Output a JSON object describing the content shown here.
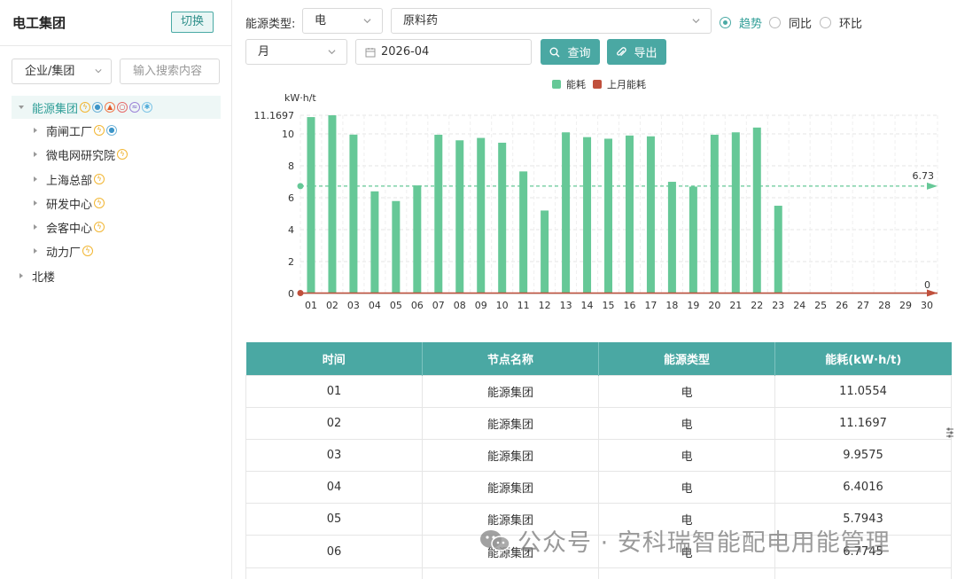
{
  "sidebar": {
    "title": "电工集团",
    "switch_label": "切换",
    "scope_select": "企业/集团",
    "search_placeholder": "输入搜索内容",
    "tree": [
      {
        "label": "能源集团",
        "level": 0,
        "expanded": true,
        "selected": true,
        "icons": [
          "electric",
          "water",
          "fire",
          "gas",
          "steam",
          "cold"
        ]
      },
      {
        "label": "南闸工厂",
        "level": 1,
        "icons": [
          "electric",
          "water"
        ]
      },
      {
        "label": "微电网研究院",
        "level": 1,
        "icons": [
          "electric"
        ]
      },
      {
        "label": "上海总部",
        "level": 1,
        "icons": [
          "electric"
        ]
      },
      {
        "label": "研发中心",
        "level": 1,
        "icons": [
          "electric"
        ]
      },
      {
        "label": "会客中心",
        "level": 1,
        "icons": [
          "electric"
        ]
      },
      {
        "label": "动力厂",
        "level": 1,
        "icons": [
          "electric"
        ]
      },
      {
        "label": "北楼",
        "level": 0,
        "icons": []
      }
    ]
  },
  "toolbar": {
    "energy_type_label": "能源类型:",
    "energy_type_value": "电",
    "material_value": "原料药",
    "radios": [
      {
        "label": "趋势",
        "checked": true
      },
      {
        "label": "同比",
        "checked": false
      },
      {
        "label": "环比",
        "checked": false
      }
    ],
    "period_value": "月",
    "date_value": "2026-04",
    "query_label": "查询",
    "export_label": "导出"
  },
  "colors": {
    "accent": "#4aa8a3",
    "bar": "#66c897",
    "prev_month": "#c0503c"
  },
  "chart_data": {
    "type": "bar",
    "unit_label": "kW·h/t",
    "legend": [
      "能耗",
      "上月能耗"
    ],
    "legend_position": "top-center",
    "categories": [
      "01",
      "02",
      "03",
      "04",
      "05",
      "06",
      "07",
      "08",
      "09",
      "10",
      "11",
      "12",
      "13",
      "14",
      "15",
      "16",
      "17",
      "18",
      "19",
      "20",
      "21",
      "22",
      "23",
      "24",
      "25",
      "26",
      "27",
      "28",
      "29",
      "30"
    ],
    "series": [
      {
        "name": "能耗",
        "values": [
          11.0554,
          11.1697,
          9.9575,
          6.4016,
          5.7943,
          6.7745,
          9.95,
          9.6,
          9.75,
          9.45,
          7.65,
          5.2,
          10.1,
          9.8,
          9.7,
          9.9,
          9.85,
          7.0,
          6.7,
          9.95,
          10.1,
          10.4,
          5.5,
          0,
          0,
          0,
          0,
          0,
          0,
          0
        ]
      },
      {
        "name": "上月能耗",
        "values": [
          0,
          0,
          0,
          0,
          0,
          0,
          0,
          0,
          0,
          0,
          0,
          0,
          0,
          0,
          0,
          0,
          0,
          0,
          0,
          0,
          0,
          0,
          0,
          0,
          0,
          0,
          0,
          0,
          0,
          0
        ]
      }
    ],
    "y_ticks": [
      "0",
      "2",
      "4",
      "6",
      "8",
      "10"
    ],
    "y_max_label": "11.1697",
    "ylim": [
      0,
      11.1697
    ],
    "average_value": 6.73,
    "average_label": "6.73",
    "prev_end_label": "0",
    "grid": true
  },
  "table": {
    "headers": [
      "时间",
      "节点名称",
      "能源类型",
      "能耗(kW·h/t)"
    ],
    "rows": [
      [
        "01",
        "能源集团",
        "电",
        "11.0554"
      ],
      [
        "02",
        "能源集团",
        "电",
        "11.1697"
      ],
      [
        "03",
        "能源集团",
        "电",
        "9.9575"
      ],
      [
        "04",
        "能源集团",
        "电",
        "6.4016"
      ],
      [
        "05",
        "能源集团",
        "电",
        "5.7943"
      ],
      [
        "06",
        "能源集团",
        "电",
        "6.7745"
      ],
      [
        "",
        "",
        "",
        ""
      ]
    ]
  },
  "watermark": "公众号 · 安科瑞智能配电用能管理"
}
